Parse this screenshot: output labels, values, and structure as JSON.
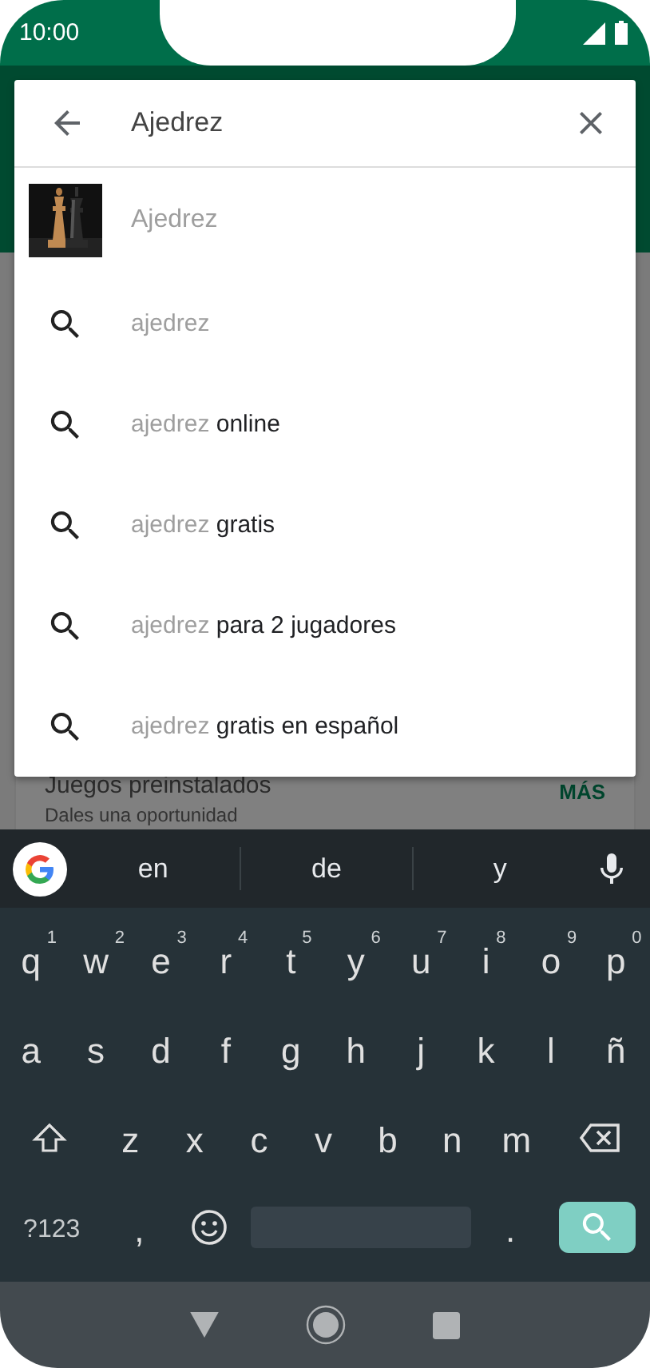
{
  "status_bar": {
    "time": "10:00"
  },
  "search": {
    "value": "Ajedrez"
  },
  "suggestions": [
    {
      "kind": "app",
      "typed": "Ajedrez"
    },
    {
      "kind": "query",
      "typed": "ajedrez"
    },
    {
      "kind": "query",
      "typed": "ajedrez",
      "completion": " online"
    },
    {
      "kind": "query",
      "typed": "ajedrez",
      "completion": " gratis"
    },
    {
      "kind": "query",
      "typed": "ajedrez",
      "completion": " para 2 jugadores"
    },
    {
      "kind": "query",
      "typed": "ajedrez",
      "completion": " gratis en español"
    }
  ],
  "background_section": {
    "title": "Juegos preinstalados",
    "subtitle": "Dales una oportunidad",
    "action": "MÁS"
  },
  "keyboard": {
    "word_suggestions": [
      "en",
      "de",
      "y"
    ],
    "rows": [
      {
        "keys": [
          {
            "kind": "char",
            "label": "q",
            "hint": "1"
          },
          {
            "kind": "char",
            "label": "w",
            "hint": "2"
          },
          {
            "kind": "char",
            "label": "e",
            "hint": "3"
          },
          {
            "kind": "char",
            "label": "r",
            "hint": "4"
          },
          {
            "kind": "char",
            "label": "t",
            "hint": "5"
          },
          {
            "kind": "char",
            "label": "y",
            "hint": "6"
          },
          {
            "kind": "char",
            "label": "u",
            "hint": "7"
          },
          {
            "kind": "char",
            "label": "i",
            "hint": "8"
          },
          {
            "kind": "char",
            "label": "o",
            "hint": "9"
          },
          {
            "kind": "char",
            "label": "p",
            "hint": "0"
          }
        ]
      },
      {
        "keys": [
          {
            "kind": "char",
            "label": "a"
          },
          {
            "kind": "char",
            "label": "s"
          },
          {
            "kind": "char",
            "label": "d"
          },
          {
            "kind": "char",
            "label": "f"
          },
          {
            "kind": "char",
            "label": "g"
          },
          {
            "kind": "char",
            "label": "h"
          },
          {
            "kind": "char",
            "label": "j"
          },
          {
            "kind": "char",
            "label": "k"
          },
          {
            "kind": "char",
            "label": "l"
          },
          {
            "kind": "char",
            "label": "ñ"
          }
        ]
      },
      {
        "keys": [
          {
            "kind": "shift"
          },
          {
            "kind": "char",
            "label": "z"
          },
          {
            "kind": "char",
            "label": "x"
          },
          {
            "kind": "char",
            "label": "c"
          },
          {
            "kind": "char",
            "label": "v"
          },
          {
            "kind": "char",
            "label": "b"
          },
          {
            "kind": "char",
            "label": "n"
          },
          {
            "kind": "char",
            "label": "m"
          },
          {
            "kind": "backspace"
          }
        ]
      },
      {
        "keys": [
          {
            "kind": "symbols",
            "label": "?123"
          },
          {
            "kind": "char",
            "label": ","
          },
          {
            "kind": "emoji"
          },
          {
            "kind": "space"
          },
          {
            "kind": "char",
            "label": "."
          },
          {
            "kind": "action"
          }
        ]
      }
    ]
  }
}
